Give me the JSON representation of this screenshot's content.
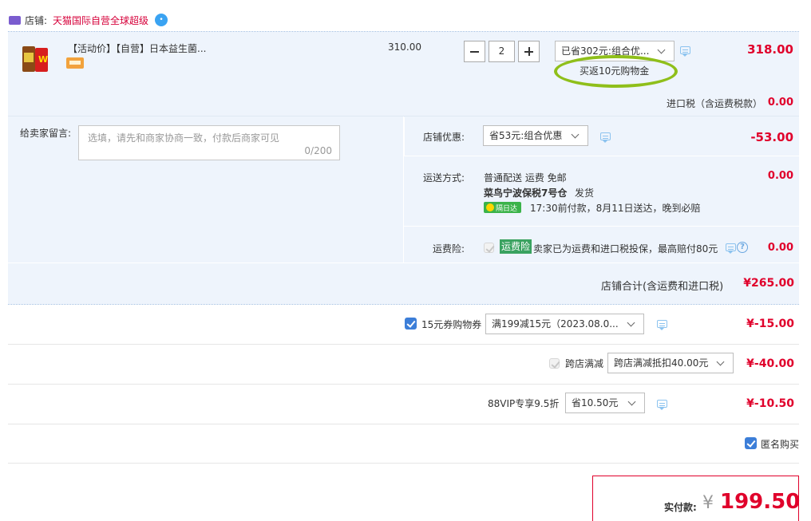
{
  "store": {
    "label": "店铺:",
    "name": "天猫国际自营全球超级"
  },
  "product": {
    "title": "【活动价】【自营】日本益生菌...",
    "unit_price": "310.00",
    "quantity": "2",
    "discount_select": "已省302元:组合优...",
    "cashback": "买返10元购物金",
    "subtotal": "318.00",
    "tax_label": "进口税（含运费税款）",
    "tax_value": "0.00"
  },
  "message": {
    "label": "给卖家留言:",
    "placeholder": "选填，请先和商家协商一致，付款后商家可见",
    "counter": "0/200"
  },
  "store_discount": {
    "label": "店铺优惠:",
    "select": "省53元:组合优惠",
    "value": "-53.00"
  },
  "shipping": {
    "label": "运送方式:",
    "line1": "普通配送 运费 免邮",
    "warehouse": "菜鸟宁波保税7号仓",
    "ship_text": "发货",
    "badge": "隔日达",
    "eta": "17:30前付款，8月11日送达，晚到必赔",
    "value": "0.00"
  },
  "freight_insurance": {
    "label": "运费险:",
    "tag": "运费险",
    "text": "卖家已为运费和进口税投保，最高赔付80元",
    "value": "0.00"
  },
  "store_total": {
    "label": "店铺合计(含运费和进口税)",
    "value": "¥265.00"
  },
  "coupon": {
    "label": "15元券购物券",
    "select": "满199减15元（2023.08.0...",
    "value": "¥-15.00"
  },
  "cross_store": {
    "label": "跨店满减",
    "select": "跨店满减抵扣40.00元",
    "value": "¥-40.00"
  },
  "vip": {
    "label": "88VIP专享9.5折",
    "select": "省10.50元",
    "value": "¥-10.50"
  },
  "anonymous": {
    "label": "匿名购买"
  },
  "payment": {
    "label": "实付款:",
    "currency": "¥",
    "amount": "199.50"
  },
  "colors": {
    "price_red": "#e0002b",
    "section_bg": "#eef4fc",
    "checkbox_blue": "#3c7ed8",
    "highlight_ring": "#8fbf1a",
    "insurance_green": "#3aa260"
  }
}
